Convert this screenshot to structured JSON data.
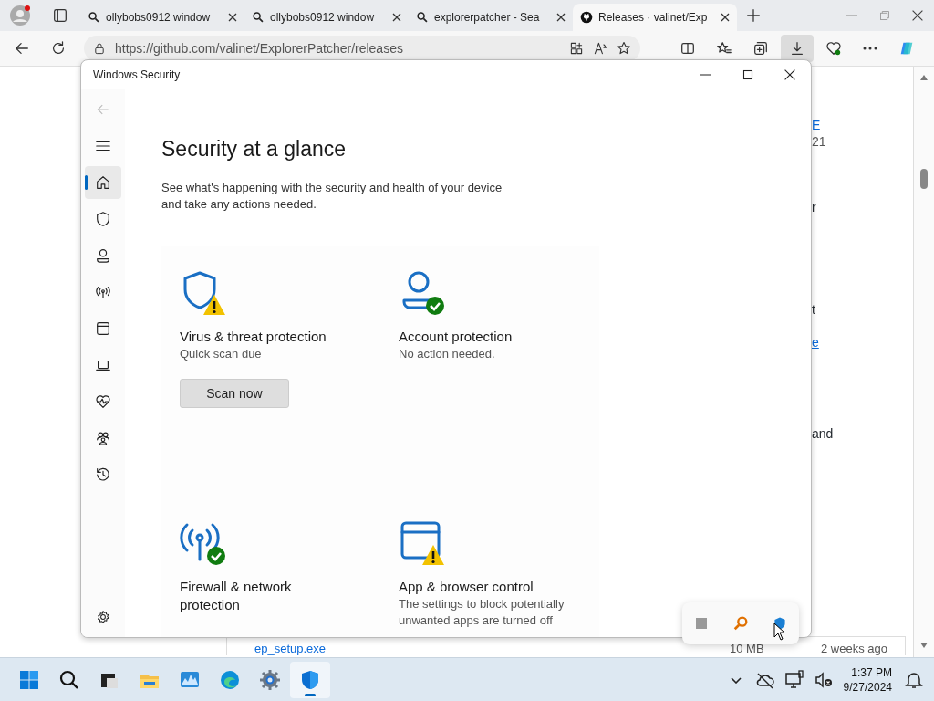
{
  "browser": {
    "tabs": [
      {
        "title": "ollybobs0912 window",
        "kind": "search",
        "selected": false
      },
      {
        "title": "ollybobs0912 window",
        "kind": "search",
        "selected": false
      },
      {
        "title": "explorerpatcher - Sea",
        "kind": "search",
        "selected": false
      },
      {
        "title": "Releases · valinet/Exp",
        "kind": "github",
        "selected": true
      }
    ],
    "url": "https://github.com/valinet/ExplorerPatcher/releases",
    "page_fragments": [
      "E",
      "21",
      "r",
      "t",
      "e",
      "and"
    ],
    "asset_row": {
      "file": "ep_setup.exe",
      "size": "10 MB",
      "age": "2 weeks ago"
    }
  },
  "window": {
    "title": "Windows Security",
    "nav_items": [
      {
        "selected": true
      },
      {
        "selected": false
      },
      {
        "selected": false
      },
      {
        "selected": false
      },
      {
        "selected": false
      },
      {
        "selected": false
      },
      {
        "selected": false
      },
      {
        "selected": false
      },
      {
        "selected": false
      }
    ],
    "heading": "Security at a glance",
    "description": "See what's happening with the security and health of your device and take any actions needed.",
    "cards": [
      {
        "kind": "virus",
        "alert": true,
        "title": "Virus & threat protection",
        "subtitle": "Quick scan due",
        "button": "Scan now"
      },
      {
        "kind": "account",
        "alert": false,
        "title": "Account protection",
        "subtitle": "No action needed."
      },
      {
        "kind": "firewall",
        "alert": false,
        "title": "Firewall & network protection"
      },
      {
        "kind": "app",
        "alert": true,
        "title": "App & browser control",
        "subtitle": "The settings to block potentially unwanted apps are turned off"
      }
    ]
  },
  "taskbar": {
    "apps": [
      {
        "kind": "files",
        "selected": false
      },
      {
        "kind": "explorer",
        "selected": false
      },
      {
        "kind": "monitor",
        "selected": false
      },
      {
        "kind": "edge",
        "selected": false
      },
      {
        "kind": "settings",
        "selected": false
      },
      {
        "kind": "security",
        "selected": true
      }
    ],
    "time": "1:37 PM",
    "date": "9/27/2024"
  }
}
